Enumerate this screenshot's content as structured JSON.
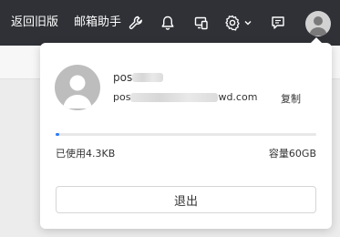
{
  "topbar": {
    "back_old_label": "返回旧版",
    "mail_assistant_label": "邮箱助手",
    "icons": [
      "wrench-icon",
      "bell-icon",
      "device-switch-icon",
      "gear-icon",
      "chevron-down-icon",
      "feedback-icon",
      "avatar-icon"
    ]
  },
  "account": {
    "name_prefix": "pos",
    "email_prefix": "pos",
    "email_suffix": "wd.com",
    "copy_label": "复制"
  },
  "storage": {
    "used_label": "已使用4.3KB",
    "capacity_label": "容量60GB",
    "used_fraction": 0.01,
    "accent": "#2d7cf6"
  },
  "actions": {
    "logout_label": "退出"
  },
  "colors": {
    "topbar_bg": "#2f3136"
  }
}
